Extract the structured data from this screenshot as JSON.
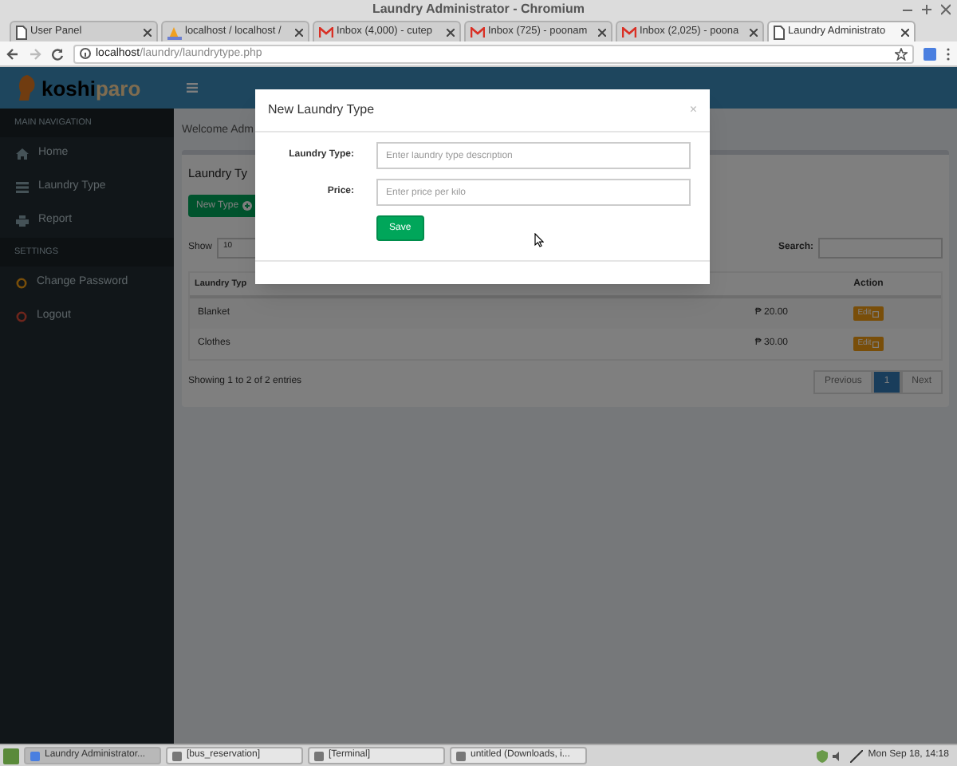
{
  "window": {
    "title": "Laundry Administrator - Chromium"
  },
  "tabs": [
    {
      "label": "User Panel",
      "selected": false,
      "kind": "page"
    },
    {
      "label": "localhost / localhost /",
      "selected": false,
      "kind": "db"
    },
    {
      "label": "Inbox (4,000) - cutep",
      "selected": false,
      "kind": "mail"
    },
    {
      "label": "Inbox (725) - poonam",
      "selected": false,
      "kind": "mail"
    },
    {
      "label": "Inbox (2,025) - poona",
      "selected": false,
      "kind": "mail"
    },
    {
      "label": "Laundry Administrato",
      "selected": true,
      "kind": "page"
    }
  ],
  "address": {
    "host": "localhost",
    "path": "/laundry/laundrytype.php"
  },
  "logo": {
    "part_1": "koshi",
    "part_2": "paro"
  },
  "sidebar": {
    "sections": [
      {
        "heading": "MAIN NAVIGATION",
        "items": [
          {
            "label": "Home",
            "kind": "home"
          },
          {
            "label": "Laundry Type",
            "kind": "list"
          },
          {
            "label": "Report",
            "kind": "print"
          }
        ]
      },
      {
        "heading": "SETTINGS",
        "items": [
          {
            "label": "Change Password",
            "kind": "ring-orange"
          },
          {
            "label": "Logout",
            "kind": "ring-red"
          }
        ]
      }
    ]
  },
  "welcome": "Welcome Adm",
  "box": {
    "title": "Laundry Ty",
    "new_button": "New Type",
    "show_label": "Show",
    "show_value": "10",
    "search_label": "Search:",
    "columns": [
      "Laundry Typ",
      "Action"
    ],
    "rows": [
      {
        "type": "Blanket",
        "price": "₱ 20.00",
        "action": "Edit"
      },
      {
        "type": "Clothes",
        "price": "₱ 30.00",
        "action": "Edit"
      }
    ],
    "info": "Showing 1 to 2 of 2 entries",
    "pages": [
      {
        "label": "Previous",
        "selected": false
      },
      {
        "label": "1",
        "selected": true
      },
      {
        "label": "Next",
        "selected": false
      }
    ]
  },
  "modal": {
    "title": "New Laundry Type",
    "close": "×",
    "fields": [
      {
        "label": "Laundry Type:",
        "placeholder": "Enter laundry type description"
      },
      {
        "label": "Price:",
        "placeholder": "Enter price per kilo"
      }
    ],
    "save": "Save"
  },
  "taskbar": {
    "items": [
      {
        "label": "Laundry Administrator...",
        "selected": true
      },
      {
        "label": "[bus_reservation]",
        "selected": false
      },
      {
        "label": "[Terminal]",
        "selected": false
      },
      {
        "label": "untitled (Downloads, i...",
        "selected": false
      }
    ],
    "clock": "Mon Sep 18, 14:18"
  }
}
